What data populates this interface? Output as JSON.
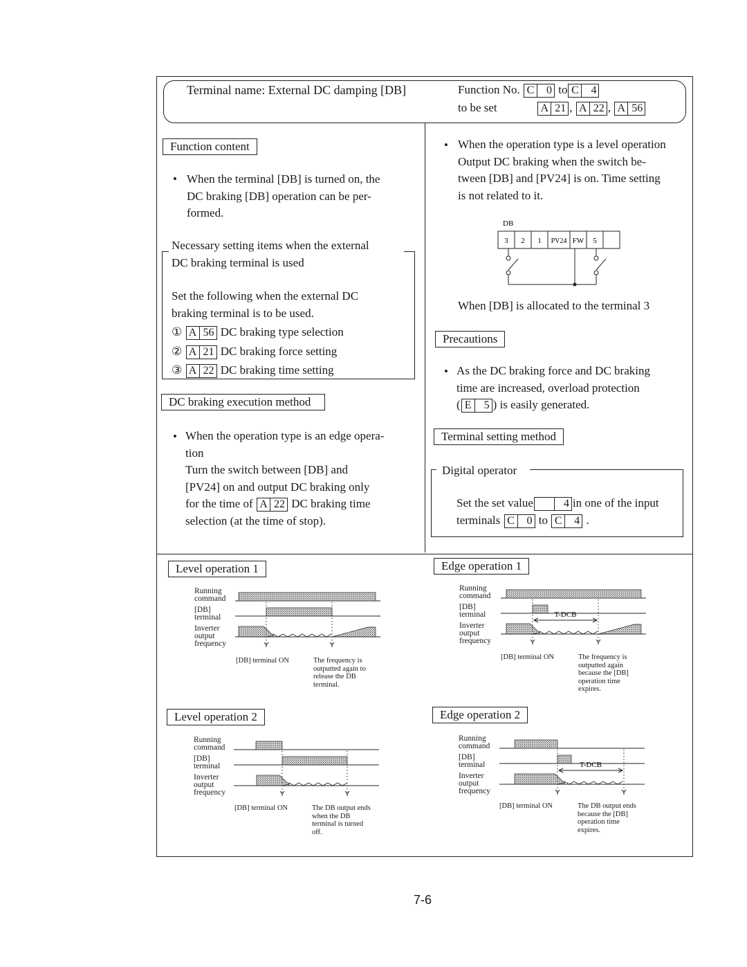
{
  "header": {
    "terminal_name": "Terminal name: External DC damping [DB]",
    "function_no_label": "Function No.",
    "to_word": "to",
    "to_be_set_label": "to be set",
    "function_codes": [
      {
        "prefix": "C",
        "num": "0"
      },
      {
        "prefix": "C",
        "num": "4"
      }
    ],
    "set_codes": [
      {
        "prefix": "A",
        "num": "21"
      },
      {
        "prefix": "A",
        "num": "22"
      },
      {
        "prefix": "A",
        "num": "56"
      }
    ],
    "comma": ","
  },
  "left": {
    "function_content": {
      "title": "Function content",
      "bullet": "•",
      "lines": [
        "When the terminal [DB] is turned on, the",
        "DC braking [DB] operation can be per-",
        "formed."
      ]
    },
    "necessary": {
      "heading_line1": "Necessary setting items when the external",
      "heading_line2": "DC braking terminal is used",
      "intro_line1": "Set the following when the external DC",
      "intro_line2": "braking terminal is to be used.",
      "items": [
        {
          "marker": "①",
          "code": {
            "prefix": "A",
            "num": "56"
          },
          "label": "DC braking type selection"
        },
        {
          "marker": "②",
          "code": {
            "prefix": "A",
            "num": "21"
          },
          "label": "DC braking force setting"
        },
        {
          "marker": "③",
          "code": {
            "prefix": "A",
            "num": "22"
          },
          "label": "DC braking time setting"
        }
      ]
    },
    "execution": {
      "title": "DC braking execution method",
      "bullet": "•",
      "lines": [
        "When the operation type is an edge opera-",
        "tion",
        "Turn the switch between [DB] and",
        "[PV24] on and output DC braking only"
      ],
      "line5_before": "for the time of",
      "line5_code": {
        "prefix": "A",
        "num": "22"
      },
      "line5_after": "DC braking time",
      "line6": "selection (at the time of stop)."
    }
  },
  "right": {
    "level_bullet": "•",
    "level_lines": [
      "When the operation type is a level operation",
      "Output DC braking when the switch be-",
      "tween [DB] and [PV24] is on.  Time setting",
      "is not related to it."
    ],
    "diagram": {
      "db_label": "DB",
      "terminals": [
        "3",
        "2",
        "1",
        "PV24",
        "FW",
        "5",
        ""
      ],
      "caption": "When [DB] is allocated to the terminal 3"
    },
    "precautions": {
      "title": "Precautions",
      "bullet": "•",
      "line1": "As the DC braking force and DC braking",
      "line2": "time are increased, overload protection",
      "line3_open": "(",
      "line3_code": {
        "prefix": "E",
        "num": "5"
      },
      "line3_after": ") is easily generated."
    },
    "terminal_setting": {
      "title": "Terminal setting method",
      "digital_operator": "Digital operator",
      "line1_before": "Set the set value",
      "line1_code": {
        "prefix": "",
        "num": "4"
      },
      "line1_after": "in one of the input",
      "line2_before": "terminals",
      "line2_code_from": {
        "prefix": "C",
        "num": "0"
      },
      "line2_to": "to",
      "line2_code_to": {
        "prefix": "C",
        "num": "4"
      },
      "line2_end": "."
    }
  },
  "timing": {
    "row_labels": {
      "running": [
        "Running",
        "command"
      ],
      "db": [
        "[DB]",
        "terminal"
      ],
      "inverter": [
        "Inverter",
        "output",
        "frequency"
      ]
    },
    "db_on_label": "[DB] terminal ON",
    "tdcb_label": "T-DCB",
    "diagrams": [
      {
        "id": "level1",
        "title": "Level operation 1",
        "note": [
          "The frequency is",
          "outputted again to",
          "release the DB",
          "terminal."
        ]
      },
      {
        "id": "edge1",
        "title": "Edge operation 1",
        "note": [
          "The frequency is",
          "outputted again",
          "because the [DB]",
          "operation time",
          "expires."
        ]
      },
      {
        "id": "level2",
        "title": "Level operation 2",
        "note": [
          "The DB output ends",
          "when the DB",
          "terminal is turned",
          "off."
        ]
      },
      {
        "id": "edge2",
        "title": "Edge operation 2",
        "note": [
          "The DB output ends",
          "because the [DB]",
          "operation time",
          "expires."
        ]
      }
    ]
  },
  "page_number": "7-6"
}
